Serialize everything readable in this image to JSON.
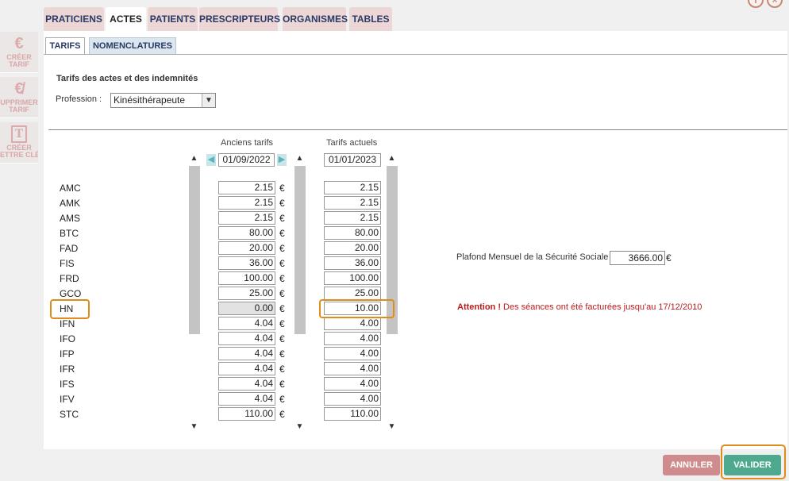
{
  "main_tabs": [
    {
      "label": "PRATICIENS",
      "active": false
    },
    {
      "label": "ACTES",
      "active": true
    },
    {
      "label": "PATIENTS",
      "active": false
    },
    {
      "label": "PRESCRIPTEURS",
      "active": false
    },
    {
      "label": "ORGANISMES",
      "active": false
    },
    {
      "label": "TABLES",
      "active": false
    }
  ],
  "sub_tabs": [
    {
      "label": "TARIFS",
      "active": true
    },
    {
      "label": "NOMENCLATURES",
      "active": false
    }
  ],
  "toolbar": [
    {
      "label_line1": "CRÉER",
      "label_line2": "TARIF",
      "icon": "euro-icon"
    },
    {
      "label_line1": "UPPRIMER",
      "label_line2": "TARIF",
      "icon": "euro-remove-icon"
    },
    {
      "label_line1": "CRÉER",
      "label_line2": "ETTRE CLÉ",
      "icon": "letter-key-icon"
    }
  ],
  "top_icons": [
    "info-icon",
    "close-icon"
  ],
  "section_title": "Tarifs des actes et des indemnités",
  "profession": {
    "label": "Profession :",
    "value": "Kinésithérapeute"
  },
  "old_tarifs": {
    "header": "Anciens tarifs",
    "date": "01/09/2022"
  },
  "new_tarifs": {
    "header": "Tarifs actuels",
    "date": "01/01/2023"
  },
  "currency": "€",
  "rows": [
    {
      "code": "AMC",
      "old": "2.15",
      "new": "2.15"
    },
    {
      "code": "AMK",
      "old": "2.15",
      "new": "2.15"
    },
    {
      "code": "AMS",
      "old": "2.15",
      "new": "2.15"
    },
    {
      "code": "BTC",
      "old": "80.00",
      "new": "80.00"
    },
    {
      "code": "FAD",
      "old": "20.00",
      "new": "20.00"
    },
    {
      "code": "FIS",
      "old": "36.00",
      "new": "36.00"
    },
    {
      "code": "FRD",
      "old": "100.00",
      "new": "100.00"
    },
    {
      "code": "GCO",
      "old": "25.00",
      "new": "25.00"
    },
    {
      "code": "HN",
      "old": "0.00",
      "new": "10.00"
    },
    {
      "code": "IFN",
      "old": "4.04",
      "new": "4.00"
    },
    {
      "code": "IFO",
      "old": "4.04",
      "new": "4.00"
    },
    {
      "code": "IFP",
      "old": "4.04",
      "new": "4.00"
    },
    {
      "code": "IFR",
      "old": "4.04",
      "new": "4.00"
    },
    {
      "code": "IFS",
      "old": "4.04",
      "new": "4.00"
    },
    {
      "code": "IFV",
      "old": "4.04",
      "new": "4.00"
    },
    {
      "code": "STC",
      "old": "110.00",
      "new": "110.00"
    }
  ],
  "plafond": {
    "label": "Plafond Mensuel de la Sécurité Sociale :",
    "value": "3666.00",
    "currency": "€"
  },
  "attention": {
    "strong": "Attention !",
    "text": " Des séances ont été facturées jusqu'au 17/12/2010"
  },
  "buttons": {
    "cancel": "ANNULER",
    "validate": "VALIDER"
  },
  "colors": {
    "highlight": "#e08c1c",
    "cancel": "#d08c8c",
    "validate": "#4ea98f",
    "attention": "#b81d1d"
  }
}
